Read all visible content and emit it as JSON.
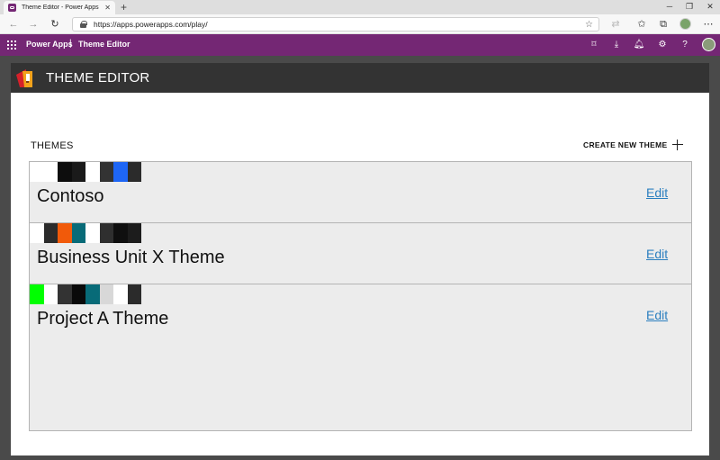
{
  "browser": {
    "tab_title": "Theme Editor - Power Apps",
    "url": "https://apps.powerapps.com/play/"
  },
  "suite_header": {
    "product": "Power Apps",
    "separator": "|",
    "app_name": "Theme Editor",
    "brand_color": "#742774"
  },
  "app": {
    "title": "THEME EDITOR",
    "themes_label": "THEMES",
    "create_label": "CREATE NEW THEME",
    "edit_label": "Edit",
    "link_color": "#2b7fbf",
    "themes": [
      {
        "name": "Contoso",
        "swatches": [
          "#ffffff",
          "#ffffff",
          "#0d0d0d",
          "#1a1a1a",
          "#ffffff",
          "#333333",
          "#1e66f5",
          "#2b2b2b"
        ]
      },
      {
        "name": "Business Unit X Theme",
        "swatches": [
          "#ffffff",
          "#2b2b2b",
          "#f15a0a",
          "#086b78",
          "#ffffff",
          "#2f2f2f",
          "#0f0f0f",
          "#1c1c1c"
        ]
      },
      {
        "name": "Project A Theme",
        "swatches": [
          "#00ff00",
          "#ffffff",
          "#333333",
          "#0a0a0a",
          "#086b78",
          "#d8d8d8",
          "#ffffff",
          "#2b2b2b"
        ]
      }
    ]
  }
}
